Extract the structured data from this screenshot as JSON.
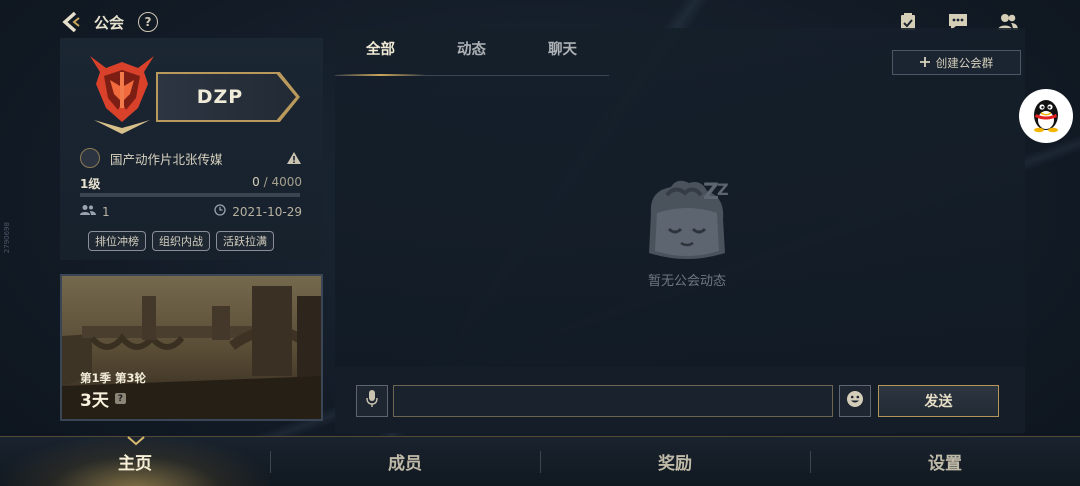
{
  "header": {
    "title": "公会",
    "help_glyph": "?"
  },
  "guild": {
    "name": "DZP",
    "leader_name": "国产动作片北张传媒",
    "level_label": "1级",
    "xp_current": "0",
    "xp_total": "/ 4000",
    "xp_progress": 0,
    "member_count": "1",
    "created_date": "2021-10-29",
    "tags": [
      "排位冲榜",
      "组织内战",
      "活跃拉满"
    ]
  },
  "season": {
    "label": "第1季 第3轮",
    "days": "3天",
    "info_glyph": "?"
  },
  "side_mark": "2790698",
  "feed": {
    "tabs": [
      "全部",
      "动态",
      "聊天"
    ],
    "active_tab": 0,
    "create_group_label": "创建公会群",
    "empty_text": "暂无公会动态"
  },
  "chat": {
    "send_label": "发送",
    "input_value": ""
  },
  "bottom_nav": {
    "items": [
      "主页",
      "成员",
      "奖励",
      "设置"
    ],
    "active": 0
  },
  "colors": {
    "accent_gold": "#c9a55c",
    "emblem_red": "#d9412b",
    "bg_dark": "#131c27"
  }
}
